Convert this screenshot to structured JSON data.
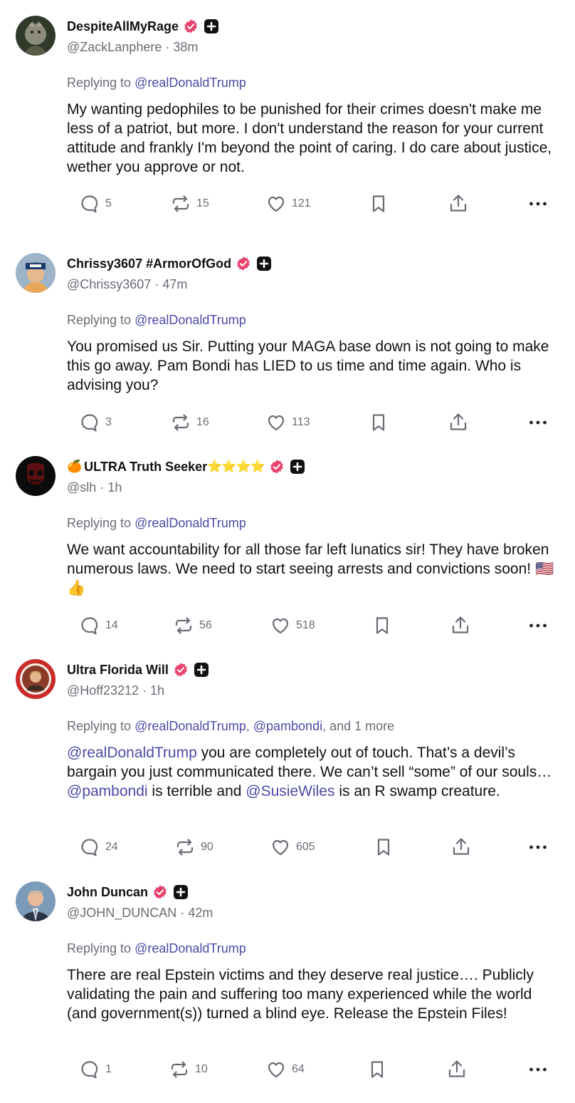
{
  "colors": {
    "mention": "#4d4aa6",
    "verified": "#e8436d",
    "muted": "#6b6b76",
    "text": "#111111"
  },
  "posts": [
    {
      "name": "DespiteAllMyRage",
      "handle": "@ZackLanphere",
      "sep": "·",
      "time": "38m",
      "replying_prefix": "Replying to ",
      "replying_mentions": [
        "@realDonaldTrump"
      ],
      "body": "My wanting pedophiles to be punished for their crimes doesn't make me less of a patriot, but more.  I don't understand the reason for your current attitude and frankly I'm beyond the point of caring.  I do care about justice, wether you approve or not.",
      "replies": "5",
      "reposts": "15",
      "likes": "121"
    },
    {
      "name": "Chrissy3607 #ArmorOfGod",
      "handle": "@Chrissy3607",
      "sep": "·",
      "time": "47m",
      "replying_prefix": "Replying to ",
      "replying_mentions": [
        "@realDonaldTrump"
      ],
      "body": "You promised us Sir.   Putting your MAGA base down is not going to make this go away.   Pam Bondi has LIED to us time and time again.  Who is advising you?",
      "replies": "3",
      "reposts": "16",
      "likes": "113"
    },
    {
      "name_emoji": "🍊",
      "name": "ULTRA Truth Seeker",
      "name_stars": "⭐⭐⭐⭐",
      "handle": "@slh",
      "sep": "·",
      "time": "1h",
      "replying_prefix": "Replying to ",
      "replying_mentions": [
        "@realDonaldTrump"
      ],
      "body": "We want accountability for all those far left lunatics sir! They have broken numerous laws. We need to start seeing arrests and convictions soon! ",
      "body_emoji": "🇺🇸👍",
      "replies": "14",
      "reposts": "56",
      "likes": "518"
    },
    {
      "name": "Ultra Florida Will",
      "handle": "@Hoff23212",
      "sep": "·",
      "time": "1h",
      "replying_prefix": "Replying to ",
      "replying_mentions": [
        "@realDonaldTrump",
        "@pambondi"
      ],
      "replying_comma": ", ",
      "replying_suffix": ", and 1 more",
      "body_parts": [
        {
          "text": "@realDonaldTrump",
          "mention": true
        },
        {
          "text": " you are completely out of touch.  That’s a devil’s bargain you just communicated there.  We can’t sell “some” of our souls…",
          "mention": false
        },
        {
          "text": "@pambondi",
          "mention": true
        },
        {
          "text": " is terrible and ",
          "mention": false
        },
        {
          "text": "@SusieWiles",
          "mention": true
        },
        {
          "text": " is an R swamp creature.",
          "mention": false
        }
      ],
      "replies": "24",
      "reposts": "90",
      "likes": "605"
    },
    {
      "name": "John Duncan",
      "handle": "@JOHN_DUNCAN",
      "sep": "·",
      "time": "42m",
      "replying_prefix": "Replying to ",
      "replying_mentions": [
        "@realDonaldTrump"
      ],
      "body": "There are real Epstein victims and they deserve real justice…. Publicly validating the pain and suffering too many experienced while the world (and government(s)) turned a blind eye. Release the Epstein Files!",
      "replies": "1",
      "reposts": "10",
      "likes": "64"
    }
  ],
  "icons": {
    "reply": "reply-icon",
    "repost": "repost-icon",
    "like": "heart-icon",
    "bookmark": "bookmark-icon",
    "share": "share-icon",
    "more": "more-icon",
    "verified": "verified-badge-icon",
    "plus": "plus-badge-icon"
  }
}
